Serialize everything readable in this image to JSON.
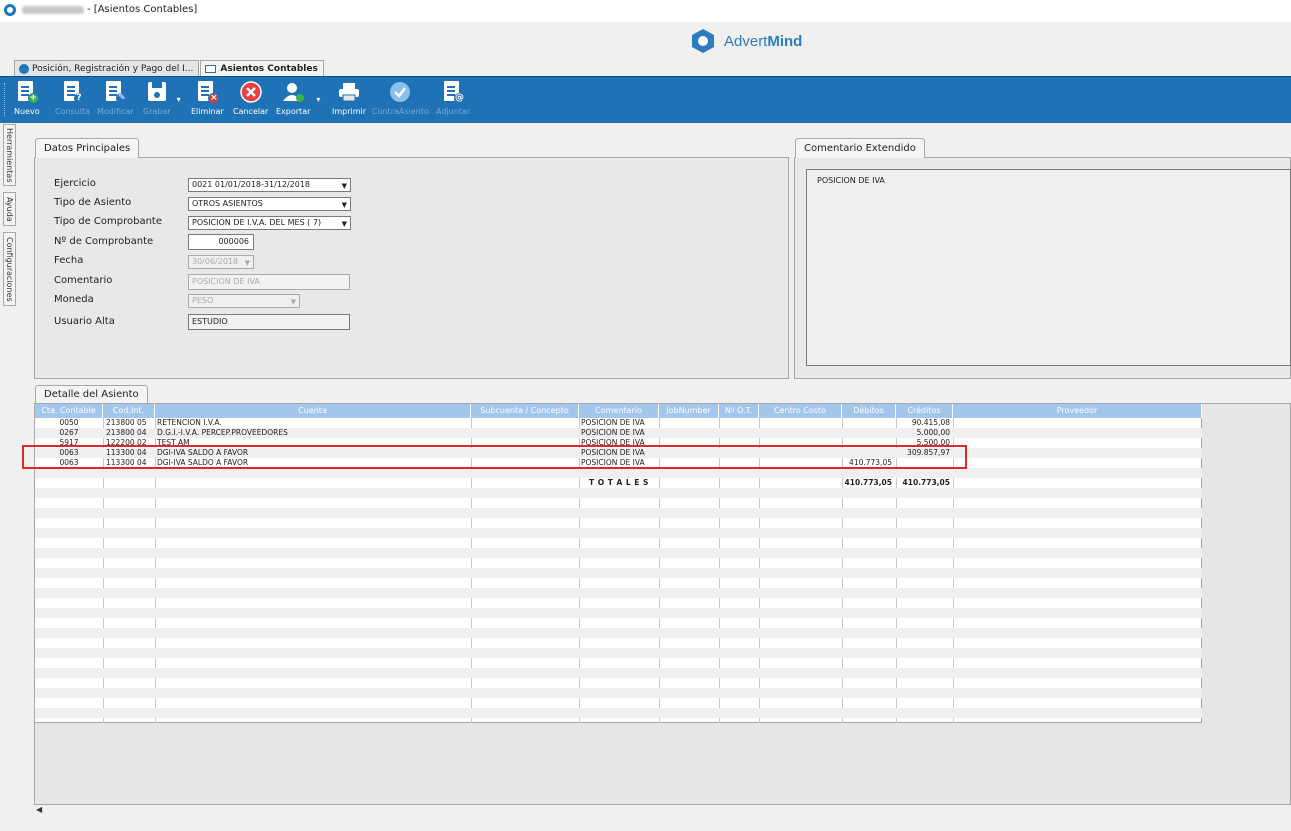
{
  "window": {
    "title": "- [Asientos Contables]"
  },
  "brand": {
    "name_light": "Advert",
    "name_bold": "Mind"
  },
  "tabs": [
    {
      "label": "Posición, Registración y Pago del I..."
    },
    {
      "label": "Asientos Contables"
    }
  ],
  "toolbar": {
    "nuevo": "Nuevo",
    "consulta": "Consulta",
    "modificar": "Modificar",
    "grabar": "Grabar",
    "eliminar": "Eliminar",
    "cancelar": "Cancelar",
    "exportar": "Exportar",
    "imprimir": "Imprimir",
    "contraasiento": "ContraAsiento",
    "adjuntar": "Adjuntar"
  },
  "side_tabs": {
    "herramientas": "Herramientas",
    "ayuda": "Ayuda",
    "configuraciones": "Configuraciones"
  },
  "datos": {
    "tab": "Datos Principales",
    "ejercicio_label": "Ejercicio",
    "ejercicio_value": "0021 01/01/2018-31/12/2018",
    "tipo_asiento_label": "Tipo de Asiento",
    "tipo_asiento_value": "OTROS ASIENTOS",
    "tipo_comprobante_label": "Tipo de Comprobante",
    "tipo_comprobante_value": "POSICION DE I.V.A. DEL MES ( 7)",
    "nro_comprobante_label": "Nº de Comprobante",
    "nro_comprobante_value": "000006",
    "fecha_label": "Fecha",
    "fecha_value": "30/06/2018",
    "comentario_label": "Comentario",
    "comentario_value": "POSICION DE IVA",
    "moneda_label": "Moneda",
    "moneda_value": "PESO",
    "usuario_label": "Usuario Alta",
    "usuario_value": "ESTUDIO"
  },
  "comentario_extendido": {
    "tab": "Comentario Extendido",
    "text": "POSICION DE IVA"
  },
  "detalle": {
    "tab": "Detalle del Asiento",
    "columns": [
      "Cta. Contable",
      "Cod.Int.",
      "Cuenta",
      "Subcuenta / Concepto",
      "Comentario",
      "JobNumber",
      "Nº O.T.",
      "Centro Costo",
      "Débitos",
      "Créditos",
      "Proveedor"
    ],
    "rows": [
      {
        "cta": "0050",
        "cod": "213800 05",
        "cuenta": "RETENCION I.V.A.",
        "comentario": "POSICION DE IVA",
        "debitos": "",
        "creditos": "90.415,08"
      },
      {
        "cta": "0267",
        "cod": "213800 04",
        "cuenta": "D.G.I.-I.V.A. PERCEP.PROVEEDORES",
        "comentario": "POSICION DE IVA",
        "debitos": "",
        "creditos": "5.000,00"
      },
      {
        "cta": "5917",
        "cod": "122200 02",
        "cuenta": "TEST AM",
        "comentario": "POSICION DE IVA",
        "debitos": "",
        "creditos": "5.500,00"
      },
      {
        "cta": "0063",
        "cod": "113300 04",
        "cuenta": "DGI-IVA SALDO A FAVOR",
        "comentario": "POSICION DE IVA",
        "debitos": "",
        "creditos": "309.857,97"
      },
      {
        "cta": "0063",
        "cod": "113300 04",
        "cuenta": "DGI-IVA SALDO A FAVOR",
        "comentario": "POSICION DE IVA",
        "debitos": "410.773,05",
        "creditos": ""
      }
    ],
    "totales_label": "T O T A L E S",
    "total_debitos": "410.773,05",
    "total_creditos": "410.773,05"
  },
  "colors": {
    "toolbar": "#1f72b6",
    "grid_header": "#a3c7ec",
    "highlight": "#e0262a",
    "brand": "#2c7dc0"
  }
}
